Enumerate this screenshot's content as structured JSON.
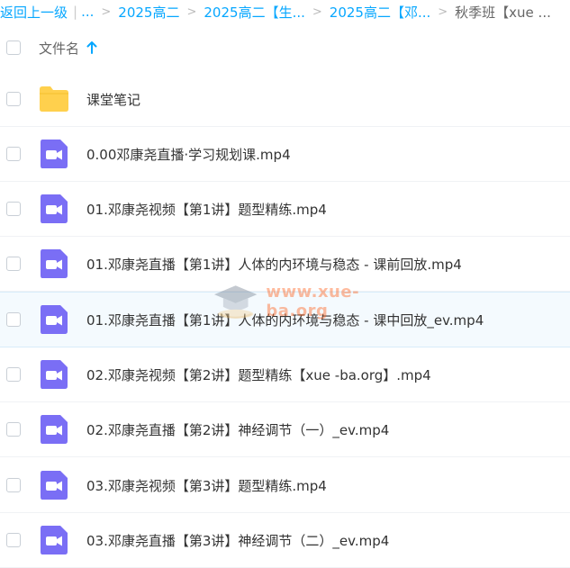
{
  "breadcrumb": {
    "back_label": "返回上一级",
    "bar": "|",
    "ellipsis": "...",
    "items": [
      "2025高二",
      "2025高二【生...",
      "2025高二【邓...",
      "秋季班【xue ..."
    ],
    "separator": ">"
  },
  "header": {
    "column_label": "文件名",
    "sort_icon": "arrow-up-icon"
  },
  "files": [
    {
      "name": "课堂笔记",
      "type": "folder"
    },
    {
      "name": "0.00邓康尧直播·学习规划课.mp4",
      "type": "video"
    },
    {
      "name": "01.邓康尧视频【第1讲】题型精练.mp4",
      "type": "video"
    },
    {
      "name": "01.邓康尧直播【第1讲】人体的内环境与稳态 - 课前回放.mp4",
      "type": "video"
    },
    {
      "name": "01.邓康尧直播【第1讲】人体的内环境与稳态 - 课中回放_ev.mp4",
      "type": "video"
    },
    {
      "name": "02.邓康尧视频【第2讲】题型精练【xue -ba.org】.mp4",
      "type": "video"
    },
    {
      "name": "02.邓康尧直播【第2讲】神经调节（一）_ev.mp4",
      "type": "video"
    },
    {
      "name": "03.邓康尧视频【第3讲】题型精练.mp4",
      "type": "video"
    },
    {
      "name": "03.邓康尧直播【第3讲】神经调节（二）_ev.mp4",
      "type": "video"
    }
  ],
  "watermark": {
    "text": "www.xue-ba.org"
  },
  "colors": {
    "link": "#06a7ff",
    "folder": "#ffd04d",
    "video": "#7a6ef5",
    "hover_row": "#f4fafe"
  }
}
